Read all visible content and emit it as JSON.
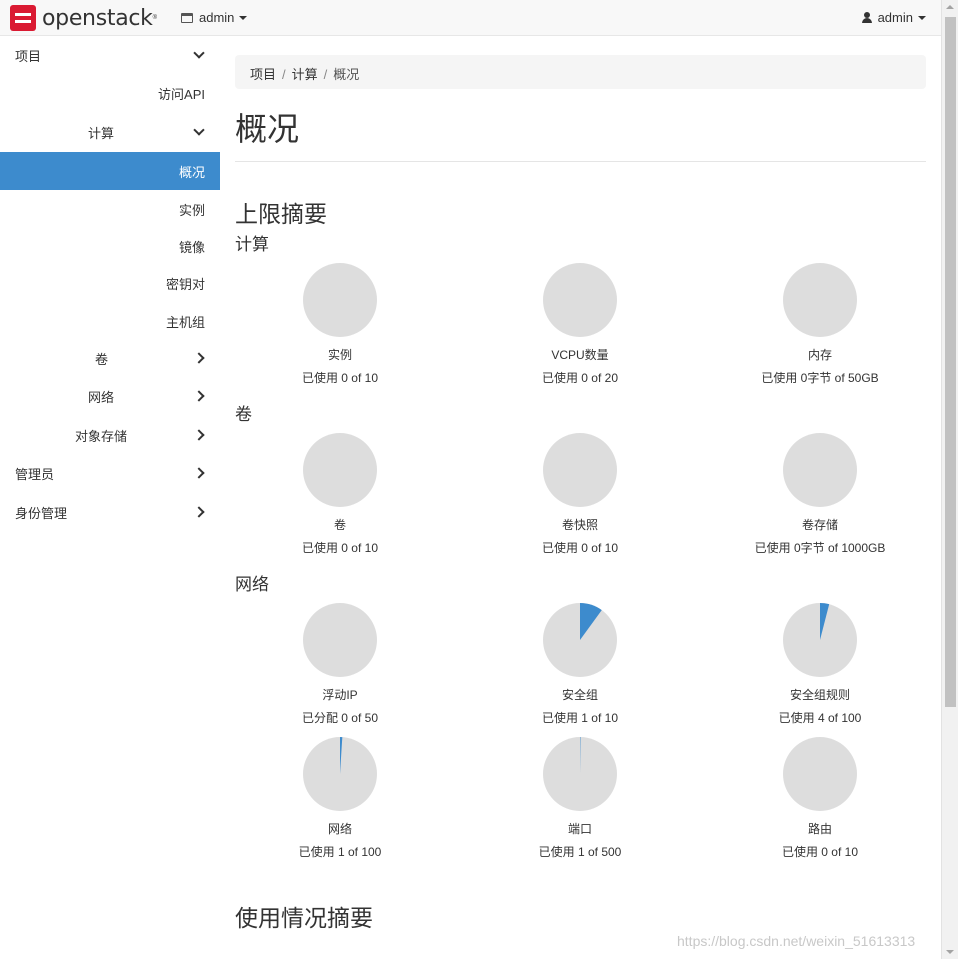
{
  "navbar": {
    "brand": "openstack",
    "brand_reg": "®",
    "project_label": "admin",
    "user_label": "admin"
  },
  "sidebar": {
    "items": [
      {
        "label": "项目",
        "chevron": "down"
      },
      {
        "label": "访问API"
      },
      {
        "label": "计算",
        "chevron": "down"
      },
      {
        "label": "概况",
        "active": true
      },
      {
        "label": "实例"
      },
      {
        "label": "镜像"
      },
      {
        "label": "密钥对"
      },
      {
        "label": "主机组"
      },
      {
        "label": "卷",
        "chevron": "right"
      },
      {
        "label": "网络",
        "chevron": "right"
      },
      {
        "label": "对象存储",
        "chevron": "right"
      },
      {
        "label": "管理员",
        "chevron": "right"
      },
      {
        "label": "身份管理",
        "chevron": "right"
      }
    ]
  },
  "breadcrumb": {
    "items": [
      "项目",
      "计算",
      "概况"
    ],
    "separator": "/"
  },
  "page_title": "概况",
  "limits": {
    "heading": "上限摘要",
    "groups": [
      {
        "title": "计算",
        "pies": [
          {
            "name": "实例",
            "usage": "已使用 0 of 10",
            "fraction": 0.0
          },
          {
            "name": "VCPU数量",
            "usage": "已使用 0 of 20",
            "fraction": 0.0
          },
          {
            "name": "内存",
            "usage": "已使用 0字节 of 50GB",
            "fraction": 0.0
          }
        ]
      },
      {
        "title": "卷",
        "pies": [
          {
            "name": "卷",
            "usage": "已使用 0 of 10",
            "fraction": 0.0
          },
          {
            "name": "卷快照",
            "usage": "已使用 0 of 10",
            "fraction": 0.0
          },
          {
            "name": "卷存储",
            "usage": "已使用 0字节 of 1000GB",
            "fraction": 0.0
          }
        ]
      },
      {
        "title": "网络",
        "pies": [
          {
            "name": "浮动IP",
            "usage": "已分配 0 of 50",
            "fraction": 0.0
          },
          {
            "name": "安全组",
            "usage": "已使用 1 of 10",
            "fraction": 0.1
          },
          {
            "name": "安全组规则",
            "usage": "已使用 4 of 100",
            "fraction": 0.04
          },
          {
            "name": "网络",
            "usage": "已使用 1 of 100",
            "fraction": 0.01
          },
          {
            "name": "端口",
            "usage": "已使用 1 of 500",
            "fraction": 0.002
          },
          {
            "name": "路由",
            "usage": "已使用 0 of 10",
            "fraction": 0.0
          }
        ]
      }
    ]
  },
  "usage_heading": "使用情况摘要",
  "watermark": "https://blog.csdn.net/weixin_51613313",
  "colors": {
    "pie_bg": "#dddddd",
    "pie_fill": "#3d8bcd",
    "active_bg": "#3d8bcd"
  }
}
